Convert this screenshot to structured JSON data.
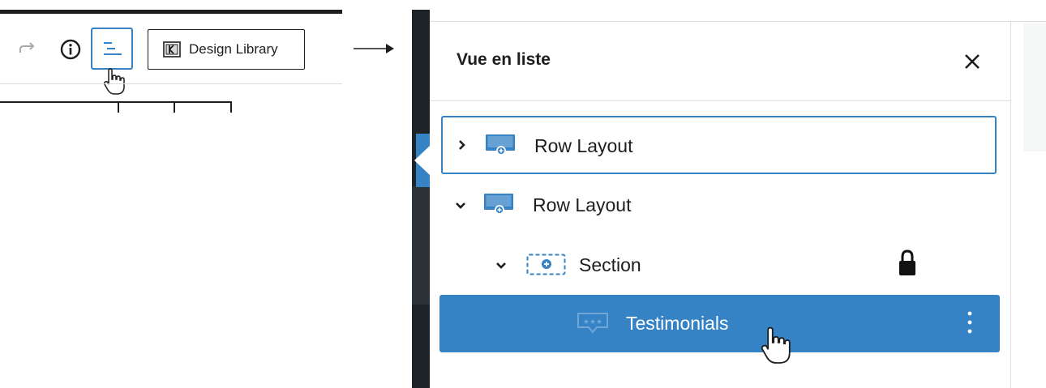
{
  "toolbar": {
    "design_library_label": "Design Library",
    "icons": [
      "redo-icon",
      "info-icon",
      "list-view-icon",
      "design-library-icon"
    ]
  },
  "panel": {
    "title": "Vue en liste",
    "close_icon": "close-icon",
    "items": [
      {
        "label": "Row Layout",
        "expanded": false,
        "selected_outline": true,
        "icon": "row-layout-icon"
      },
      {
        "label": "Row Layout",
        "expanded": true,
        "icon": "row-layout-icon"
      },
      {
        "label": "Section",
        "expanded": true,
        "locked": true,
        "icon": "section-icon"
      },
      {
        "label": "Testimonials",
        "selected": true,
        "icon": "testimonials-icon"
      }
    ]
  },
  "colors": {
    "accent": "#3582c4",
    "dark": "#1d2327",
    "text": "#1e1e1e"
  }
}
